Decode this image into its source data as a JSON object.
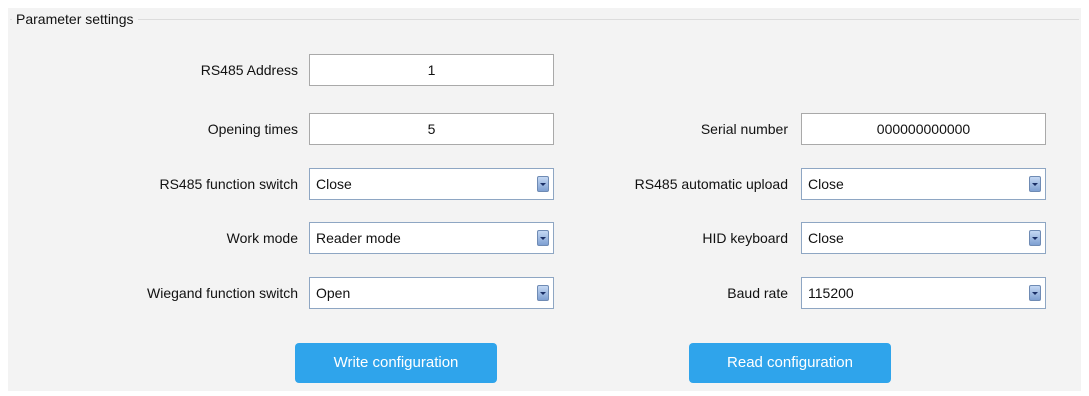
{
  "group": {
    "title": "Parameter settings"
  },
  "left": {
    "rs485_address": {
      "label": "RS485 Address",
      "value": "1"
    },
    "opening_times": {
      "label": "Opening times",
      "value": "5"
    },
    "rs485_function_switch": {
      "label": "RS485 function switch",
      "value": "Close"
    },
    "work_mode": {
      "label": "Work mode",
      "value": "Reader mode"
    },
    "wiegand_function_switch": {
      "label": "Wiegand function switch",
      "value": "Open"
    }
  },
  "right": {
    "serial_number": {
      "label": "Serial number",
      "value": "000000000000"
    },
    "rs485_automatic_upload": {
      "label": "RS485 automatic upload",
      "value": "Close"
    },
    "hid_keyboard": {
      "label": "HID keyboard",
      "value": "Close"
    },
    "baud_rate": {
      "label": "Baud rate",
      "value": "115200"
    }
  },
  "buttons": {
    "write": "Write configuration",
    "read": "Read configuration"
  },
  "icons": {
    "dropdown": "chevron-down-icon"
  },
  "colors": {
    "button_bg": "#2fa4eb",
    "panel_bg": "#f3f3f3"
  }
}
